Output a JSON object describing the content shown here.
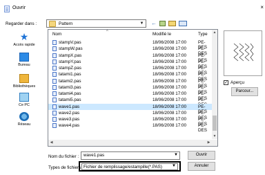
{
  "window": {
    "title": "Ouvrir",
    "close_glyph": "×"
  },
  "toolbar": {
    "lookin_label": "Regarder dans :",
    "lookin_value": "Pattern",
    "back_glyph": "←"
  },
  "places": [
    {
      "label": "Accès rapide",
      "icon": "quick-access-icon"
    },
    {
      "label": "Bureau",
      "icon": "desktop-icon"
    },
    {
      "label": "Bibliothèques",
      "icon": "libraries-icon"
    },
    {
      "label": "Ce PC",
      "icon": "computer-icon"
    },
    {
      "label": "Réseau",
      "icon": "network-icon"
    }
  ],
  "columns": {
    "name": "Nom",
    "modified": "Modifié le",
    "type": "Type"
  },
  "files": [
    {
      "name": "stampV.pas",
      "modified": "18/06/2008 17:00",
      "type": "PE-DES"
    },
    {
      "name": "stampW.pas",
      "modified": "18/06/2008 17:00",
      "type": "PE-DES"
    },
    {
      "name": "stampX.pas",
      "modified": "18/06/2008 17:00",
      "type": "PE-DES"
    },
    {
      "name": "stampY.pas",
      "modified": "18/06/2008 17:00",
      "type": "PE-DES"
    },
    {
      "name": "stampZ.pas",
      "modified": "18/06/2008 17:00",
      "type": "PE-DES"
    },
    {
      "name": "tatami1.pas",
      "modified": "18/06/2008 17:00",
      "type": "PE-DES"
    },
    {
      "name": "tatami2.pas",
      "modified": "18/06/2008 17:00",
      "type": "PE-DES"
    },
    {
      "name": "tatami3.pas",
      "modified": "18/06/2008 17:00",
      "type": "PE-DES"
    },
    {
      "name": "tatami4.pas",
      "modified": "18/06/2008 17:00",
      "type": "PE-DES"
    },
    {
      "name": "tatami5.pas",
      "modified": "18/06/2008 17:00",
      "type": "PE-DES"
    },
    {
      "name": "wave1.pas",
      "modified": "18/06/2008 17:00",
      "type": "PE-DES",
      "selected": true
    },
    {
      "name": "wave2.pas",
      "modified": "18/06/2008 17:00",
      "type": "PE-DES"
    },
    {
      "name": "wave3.pas",
      "modified": "18/06/2008 17:00",
      "type": "PE-DES"
    },
    {
      "name": "wave4.pas",
      "modified": "18/06/2008 17:00",
      "type": "PE-DES"
    }
  ],
  "preview": {
    "apercu_label": "Aperçu",
    "apercu_checked": true,
    "browse_label": "Parcour..."
  },
  "footer": {
    "filename_label": "Nom du fichier :",
    "filename_value": "wave1.pas",
    "filetype_label": "Types de fichiers",
    "filetype_value": "Fichier de remplissage/estampille(*.PAS)",
    "open_label": "Ouvrir",
    "cancel_label": "Annuler"
  }
}
